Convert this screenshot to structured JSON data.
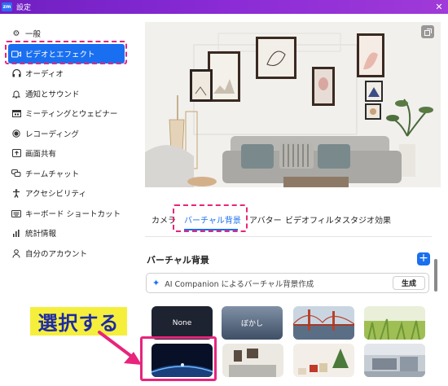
{
  "window": {
    "title": "設定",
    "logo": "zm",
    "close": "✕"
  },
  "sidebar": {
    "items": [
      {
        "label": "一般",
        "icon": "gear-icon"
      },
      {
        "label": "ビデオとエフェクト",
        "icon": "video-camera-icon",
        "active": true
      },
      {
        "label": "オーディオ",
        "icon": "headphones-icon"
      },
      {
        "label": "通知とサウンド",
        "icon": "bell-icon"
      },
      {
        "label": "ミーティングとウェビナー",
        "icon": "calendar-icon"
      },
      {
        "label": "レコーディング",
        "icon": "record-icon"
      },
      {
        "label": "画面共有",
        "icon": "share-screen-icon"
      },
      {
        "label": "チームチャット",
        "icon": "chat-icon"
      },
      {
        "label": "アクセシビリティ",
        "icon": "accessibility-icon"
      },
      {
        "label": "キーボード ショートカット",
        "icon": "keyboard-icon"
      },
      {
        "label": "統計情報",
        "icon": "stats-icon"
      },
      {
        "label": "自分のアカウント",
        "icon": "person-icon"
      }
    ]
  },
  "tabs": [
    {
      "label": "カメラ"
    },
    {
      "label": "バーチャル背景",
      "active": true
    },
    {
      "label": "アバター"
    },
    {
      "label": "ビデオフィルタ"
    },
    {
      "label": "スタジオ効果"
    }
  ],
  "section": {
    "title": "バーチャル背景",
    "add": "+"
  },
  "ai_bar": {
    "text": "AI Companion によるバーチャル背景作成",
    "button": "生成"
  },
  "backgrounds": [
    {
      "label": "None"
    },
    {
      "label": "ぼかし"
    },
    {
      "label": ""
    },
    {
      "label": ""
    },
    {
      "label": ""
    },
    {
      "label": ""
    },
    {
      "label": ""
    },
    {
      "label": ""
    }
  ],
  "annotation": {
    "callout": "選択する"
  },
  "colors": {
    "accent": "#1a6ff0",
    "highlight": "#e8247c",
    "callout_bg": "#f5ef3c",
    "callout_text": "#1d2aa5",
    "titlebar": "#8a2bd6"
  }
}
